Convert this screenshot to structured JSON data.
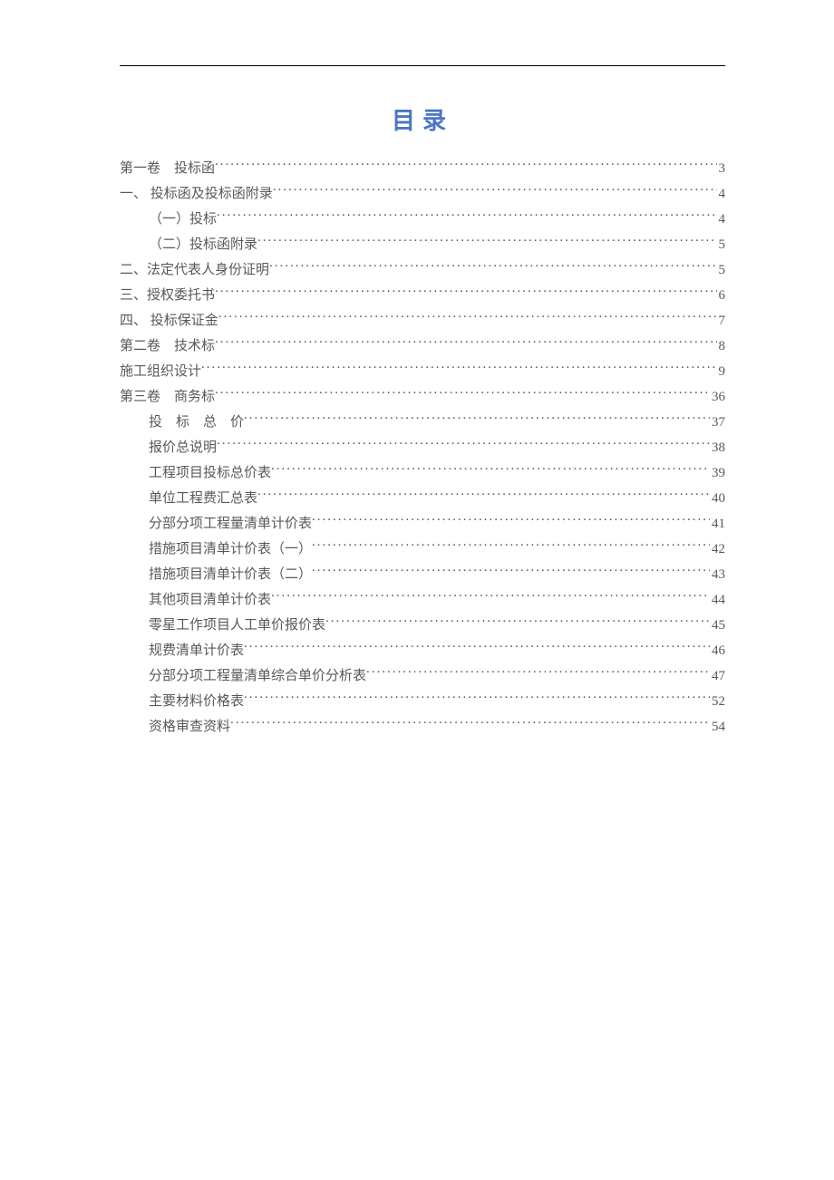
{
  "title": "目录",
  "toc": [
    {
      "level": 0,
      "label": "第一卷　投标函",
      "page": "3"
    },
    {
      "level": 1,
      "label": "一、 投标函及投标函附录",
      "page": "4"
    },
    {
      "level": 2,
      "label": "（一）投标",
      "page": "4"
    },
    {
      "level": 2,
      "label": "（二）投标函附录",
      "page": "5"
    },
    {
      "level": 1,
      "label": "二、法定代表人身份证明",
      "page": "5"
    },
    {
      "level": 1,
      "label": "三、授权委托书",
      "page": "6"
    },
    {
      "level": 1,
      "label": "四、 投标保证金",
      "page": "7"
    },
    {
      "level": 0,
      "label": "第二卷　技术标",
      "page": "8"
    },
    {
      "level": 1,
      "label": "施工组织设计",
      "page": "9"
    },
    {
      "level": 0,
      "label": "第三卷　商务标",
      "page": "36"
    },
    {
      "level": 2,
      "label": "投　标　总　价",
      "page": "37",
      "spaced": false
    },
    {
      "level": 2,
      "label": "报价总说明",
      "page": "38"
    },
    {
      "level": 2,
      "label": "工程项目投标总价表",
      "page": "39"
    },
    {
      "level": 2,
      "label": "单位工程费汇总表",
      "page": "40"
    },
    {
      "level": 2,
      "label": "分部分项工程量清单计价表",
      "page": "41"
    },
    {
      "level": 2,
      "label": "措施项目清单计价表（一）",
      "page": "42"
    },
    {
      "level": 2,
      "label": "措施项目清单计价表（二）",
      "page": "43"
    },
    {
      "level": 2,
      "label": "其他项目清单计价表",
      "page": "44"
    },
    {
      "level": 2,
      "label": "零星工作项目人工单价报价表",
      "page": "45"
    },
    {
      "level": 2,
      "label": "规费清单计价表",
      "page": "46"
    },
    {
      "level": 2,
      "label": "分部分项工程量清单综合单价分析表",
      "page": "47"
    },
    {
      "level": 2,
      "label": "主要材料价格表",
      "page": "52"
    },
    {
      "level": 2,
      "label": "资格审查资料",
      "page": "54"
    }
  ]
}
